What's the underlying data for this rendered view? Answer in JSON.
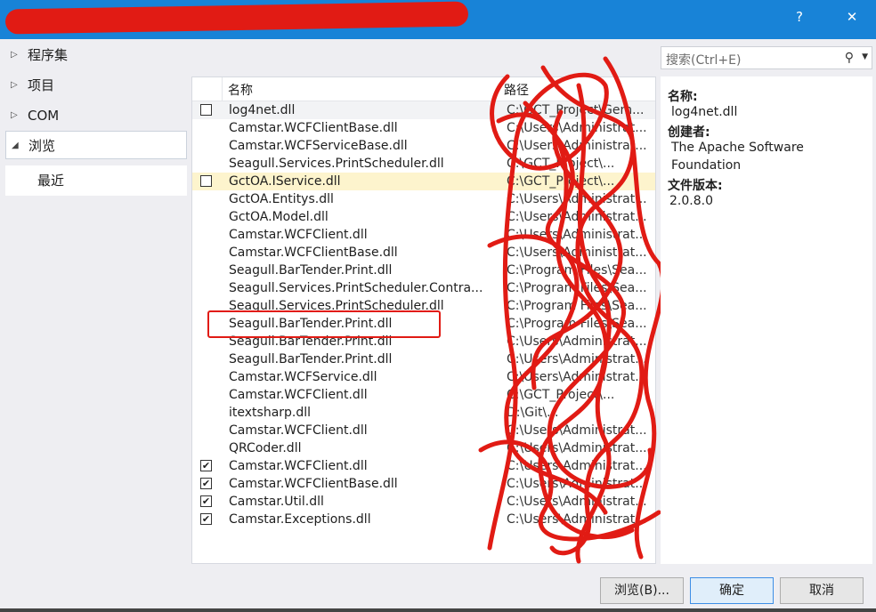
{
  "window": {
    "title": "",
    "help_label": "?",
    "close_label": "✕"
  },
  "nav": {
    "items": [
      {
        "label": "程序集",
        "arrow": "▷"
      },
      {
        "label": "项目",
        "arrow": "▷"
      },
      {
        "label": "COM",
        "arrow": "▷"
      },
      {
        "label": "浏览",
        "arrow": "◢"
      }
    ],
    "sub": {
      "label": "最近"
    }
  },
  "search": {
    "placeholder": "搜索(Ctrl+E)",
    "icon": "search-icon"
  },
  "list": {
    "col_name": "名称",
    "col_path": "路径",
    "rows": [
      {
        "name": "log4net.dll",
        "path": "C:\\GCT_Project\\Gem...",
        "checkbox": "unchecked"
      },
      {
        "name": "Camstar.WCFClientBase.dll",
        "path": "C:\\Users\\Administrat...",
        "checkbox": "none"
      },
      {
        "name": "Camstar.WCFServiceBase.dll",
        "path": "C:\\Users\\Administrat...",
        "checkbox": "none"
      },
      {
        "name": "Seagull.Services.PrintScheduler.dll",
        "path": "C:\\GCT_Project\\...",
        "checkbox": "none"
      },
      {
        "name": "GctOA.IService.dll",
        "path": "C:\\GCT_Project\\...",
        "checkbox": "unchecked"
      },
      {
        "name": "GctOA.Entitys.dll",
        "path": "C:\\Users\\Administrat...",
        "checkbox": "none"
      },
      {
        "name": "GctOA.Model.dll",
        "path": "C:\\Users\\Administrat...",
        "checkbox": "none"
      },
      {
        "name": "Camstar.WCFClient.dll",
        "path": "C:\\Users\\Administrat...",
        "checkbox": "none"
      },
      {
        "name": "Camstar.WCFClientBase.dll",
        "path": "C:\\Users\\Administrat...",
        "checkbox": "none"
      },
      {
        "name": "Seagull.BarTender.Print.dll",
        "path": "C:\\Program Files\\Sea...",
        "checkbox": "none"
      },
      {
        "name": "Seagull.Services.PrintScheduler.Contra...",
        "path": "C:\\Program Files\\Sea...",
        "checkbox": "none"
      },
      {
        "name": "Seagull.Services.PrintScheduler.dll",
        "path": "C:\\Program Files\\Sea...",
        "checkbox": "none"
      },
      {
        "name": "Seagull.BarTender.Print.dll",
        "path": "C:\\Program Files\\Sea...",
        "checkbox": "none"
      },
      {
        "name": "Seagull.BarTender.Print.dll",
        "path": "C:\\Users\\Administrat...",
        "checkbox": "none"
      },
      {
        "name": "Seagull.BarTender.Print.dll",
        "path": "C:\\Users\\Administrat...",
        "checkbox": "none"
      },
      {
        "name": "Camstar.WCFService.dll",
        "path": "C:\\Users\\Administrat...",
        "checkbox": "none"
      },
      {
        "name": "Camstar.WCFClient.dll",
        "path": "C:\\GCT_Project\\...",
        "checkbox": "none"
      },
      {
        "name": "itextsharp.dll",
        "path": "D:\\Git\\...",
        "checkbox": "none"
      },
      {
        "name": "Camstar.WCFClient.dll",
        "path": "C:\\Users\\Administrat...",
        "checkbox": "none"
      },
      {
        "name": "QRCoder.dll",
        "path": "C:\\Users\\Administrat...",
        "checkbox": "none"
      },
      {
        "name": "Camstar.WCFClient.dll",
        "path": "C:\\Users\\Administrat...",
        "checkbox": "checked"
      },
      {
        "name": "Camstar.WCFClientBase.dll",
        "path": "C:\\Users\\Administrat...",
        "checkbox": "checked"
      },
      {
        "name": "Camstar.Util.dll",
        "path": "C:\\Users\\Administrat...",
        "checkbox": "checked"
      },
      {
        "name": "Camstar.Exceptions.dll",
        "path": "C:\\Users\\Administrat...",
        "checkbox": "checked"
      }
    ]
  },
  "details": {
    "name_label": "名称:",
    "name_value": "log4net.dll",
    "creator_label": "创建者:",
    "creator_value_1": "The Apache Software",
    "creator_value_2": "Foundation",
    "version_label": "文件版本:",
    "version_value": "2.0.8.0"
  },
  "buttons": {
    "browse": "浏览(B)...",
    "ok": "确定",
    "cancel": "取消"
  },
  "colors": {
    "titlebar": "#1883d7",
    "redaction": "#e11b14",
    "selected_row": "#fdf4cd",
    "primary_button_border": "#3d8ee6"
  }
}
